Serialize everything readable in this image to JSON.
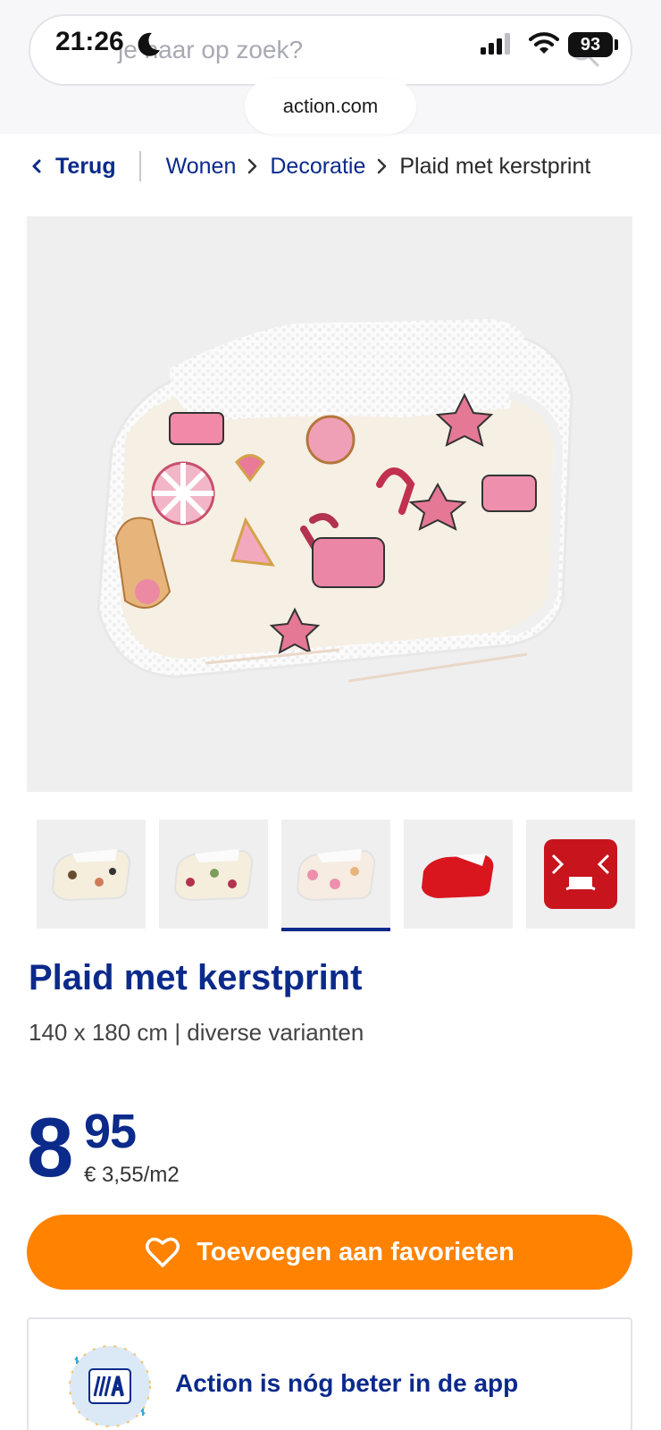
{
  "status_bar": {
    "time": "21:26",
    "battery": "93"
  },
  "search": {
    "placeholder": "je naar op zoek?"
  },
  "browser": {
    "domain": "action.com"
  },
  "breadcrumb": {
    "back_label": "Terug",
    "items": [
      "Wonen",
      "Decoratie"
    ],
    "current": "Plaid met kerstprint"
  },
  "gallery": {
    "thumbnails": [
      "thumb-cream-bears",
      "thumb-cream-gingerbread",
      "thumb-cream-cupcakes",
      "thumb-red-plain",
      "thumb-red-nordic"
    ],
    "active_index": 2
  },
  "product": {
    "title": "Plaid met kerstprint",
    "subtitle": "140 x 180 cm | diverse varianten",
    "price_major": "8",
    "price_minor": "95",
    "unit_price": "€ 3,55/m2"
  },
  "actions": {
    "favorite_label": "Toevoegen aan favorieten"
  },
  "app_promo": {
    "text": "Action is nóg beter in de app"
  },
  "colors": {
    "brand_blue": "#0b2a8a",
    "accent_orange": "#ff8200",
    "image_bg": "#efeff0"
  }
}
